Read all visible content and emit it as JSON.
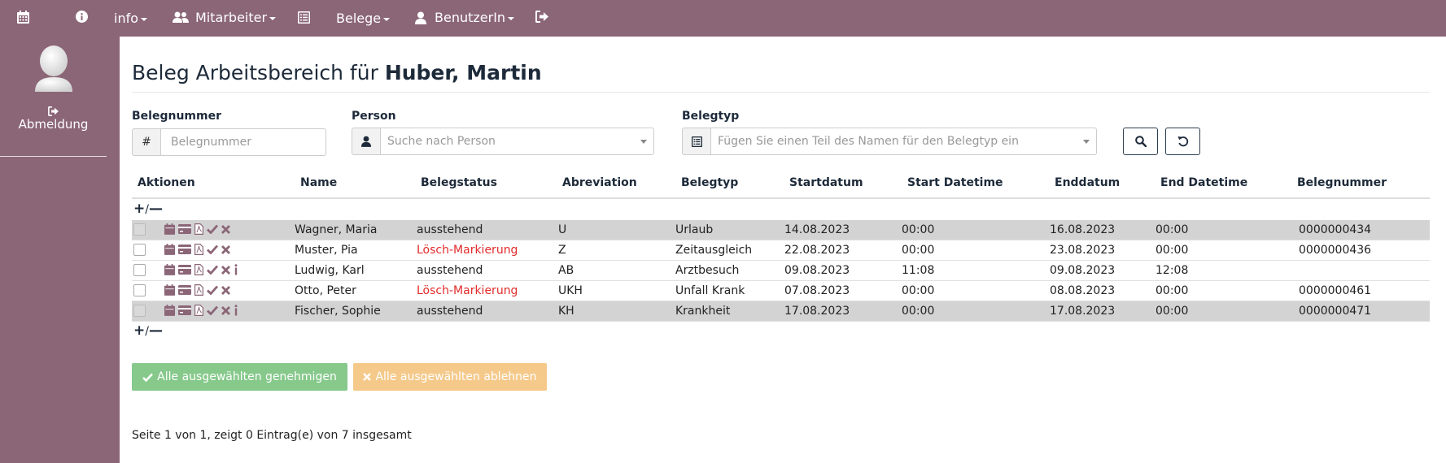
{
  "topnav": {
    "info_label": "info",
    "mitarbeiter_label": "Mitarbeiter",
    "belege_label": "Belege",
    "benutzer_label": "BenutzerIn"
  },
  "sidebar": {
    "logout_label": "Abmeldung"
  },
  "page": {
    "title_prefix": "Beleg Arbeitsbereich für",
    "title_name": "Huber, Martin"
  },
  "filters": {
    "belegnummer": {
      "label": "Belegnummer",
      "addon": "#",
      "placeholder": "Belegnummer"
    },
    "person": {
      "label": "Person",
      "placeholder": "Suche nach Person"
    },
    "belegtyp": {
      "label": "Belegtyp",
      "placeholder": "Fügen Sie einen Teil des Namen für den Belegtyp ein"
    }
  },
  "table": {
    "columns": [
      "Aktionen",
      "Name",
      "Belegstatus",
      "Abreviation",
      "Belegtyp",
      "Startdatum",
      "Start Datetime",
      "Enddatum",
      "End Datetime",
      "Belegnummer"
    ],
    "expand_label": "/",
    "rows": [
      {
        "name": "Wagner, Maria",
        "status": "ausstehend",
        "abbr": "U",
        "typ": "Urlaub",
        "start": "14.08.2023",
        "start_time": "00:00",
        "end": "16.08.2023",
        "end_time": "00:00",
        "nr": "0000000434"
      },
      {
        "name": "Muster, Pia",
        "status": "Lösch-Markierung",
        "abbr": "Z",
        "typ": "Zeitausgleich",
        "start": "22.08.2023",
        "start_time": "00:00",
        "end": "23.08.2023",
        "end_time": "00:00",
        "nr": "0000000436"
      },
      {
        "name": "Ludwig, Karl",
        "status": "ausstehend",
        "abbr": "AB",
        "typ": "Arztbesuch",
        "start": "09.08.2023",
        "start_time": "11:08",
        "end": "09.08.2023",
        "end_time": "12:08",
        "nr": ""
      },
      {
        "name": "Otto, Peter",
        "status": "Lösch-Markierung",
        "abbr": "UKH",
        "typ": "Unfall Krank",
        "start": "07.08.2023",
        "start_time": "00:00",
        "end": "08.08.2023",
        "end_time": "00:00",
        "nr": "0000000461"
      },
      {
        "name": "Fischer, Sophie",
        "status": "ausstehend",
        "abbr": "KH",
        "typ": "Krankheit",
        "start": "17.08.2023",
        "start_time": "00:00",
        "end": "17.08.2023",
        "end_time": "00:00",
        "nr": "0000000471"
      }
    ]
  },
  "actions": {
    "approve_all": "Alle ausgewählten genehmigen",
    "reject_all": "Alle ausgewählten ablehnen"
  },
  "pager": {
    "text": "Seite 1 von 1, zeigt 0 Eintrag(e) von 7 insgesamt"
  },
  "colors": {
    "brand": "#8b6677",
    "action_icon": "#8b6677",
    "status_red": "#e32b2b",
    "approve": "#86c98b",
    "reject": "#f5c98a"
  }
}
